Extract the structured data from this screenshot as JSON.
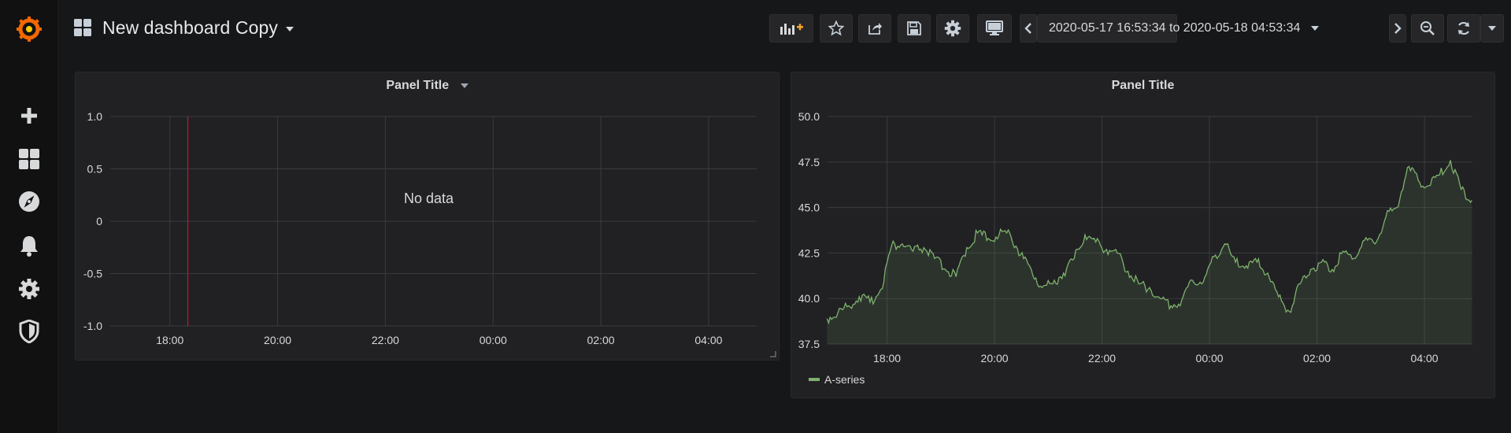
{
  "dashboard": {
    "title": "New dashboard Copy"
  },
  "toolbar": {
    "buttons": [
      "add-panel-icon",
      "star-icon",
      "share-icon",
      "save-icon",
      "gear-icon",
      "tv-mode-icon"
    ],
    "time_range": "2020-05-17 16:53:34 to 2020-05-18 04:53:34"
  },
  "sidebar": {
    "icons": [
      "grafana-logo-icon",
      "plus-icon",
      "dashboards-icon",
      "explore-compass-icon",
      "bell-icon",
      "gear-icon",
      "shield-icon"
    ]
  },
  "colors": {
    "series": "#7eb26d",
    "threshold_line": "#c4162a",
    "logo": "#f46800"
  },
  "panels": [
    {
      "title": "Panel Title",
      "message": "No data"
    },
    {
      "title": "Panel Title",
      "legend": "A-series"
    }
  ],
  "chart_data": [
    {
      "type": "line",
      "title": "Panel Title",
      "x_ticks": [
        "18:00",
        "20:00",
        "22:00",
        "00:00",
        "02:00",
        "04:00"
      ],
      "y_ticks": [
        "1.0",
        "0.5",
        "0",
        "-0.5",
        "-1.0"
      ],
      "ylim": [
        -1.0,
        1.0
      ],
      "xlim": [
        "2020-05-17 16:53:34",
        "2020-05-18 04:53:34"
      ],
      "series": [],
      "annotation_time": "2020-05-17 18:20",
      "grid": true
    },
    {
      "type": "area",
      "title": "Panel Title",
      "x_ticks": [
        "18:00",
        "20:00",
        "22:00",
        "00:00",
        "02:00",
        "04:00"
      ],
      "y_ticks": [
        "50.0",
        "47.5",
        "45.0",
        "42.5",
        "40.0",
        "37.5"
      ],
      "ylim": [
        37.5,
        50.0
      ],
      "xlim": [
        "2020-05-17 16:53:34",
        "2020-05-18 04:53:34"
      ],
      "grid": true,
      "legend": "bottom-left",
      "series": [
        {
          "name": "A-series",
          "points": [
            [
              "2020-05-17 16:53",
              38.9
            ],
            [
              "2020-05-17 17:05",
              39.2
            ],
            [
              "2020-05-17 17:17",
              39.6
            ],
            [
              "2020-05-17 17:29",
              40.1
            ],
            [
              "2020-05-17 17:41",
              39.8
            ],
            [
              "2020-05-17 17:53",
              40.5
            ],
            [
              "2020-05-17 18:05",
              42.9
            ],
            [
              "2020-05-17 18:17",
              43.0
            ],
            [
              "2020-05-17 18:29",
              42.6
            ],
            [
              "2020-05-17 18:41",
              42.8
            ],
            [
              "2020-05-17 18:53",
              42.2
            ],
            [
              "2020-05-17 19:05",
              41.6
            ],
            [
              "2020-05-17 19:17",
              41.2
            ],
            [
              "2020-05-17 19:29",
              42.8
            ],
            [
              "2020-05-17 19:41",
              43.6
            ],
            [
              "2020-05-17 19:53",
              43.3
            ],
            [
              "2020-05-17 20:05",
              43.5
            ],
            [
              "2020-05-17 20:17",
              43.6
            ],
            [
              "2020-05-17 20:29",
              42.4
            ],
            [
              "2020-05-17 20:41",
              41.6
            ],
            [
              "2020-05-17 20:53",
              40.6
            ],
            [
              "2020-05-17 21:05",
              40.8
            ],
            [
              "2020-05-17 21:17",
              41.4
            ],
            [
              "2020-05-17 21:29",
              42.2
            ],
            [
              "2020-05-17 21:41",
              43.5
            ],
            [
              "2020-05-17 21:53",
              43.1
            ],
            [
              "2020-05-17 22:05",
              42.7
            ],
            [
              "2020-05-17 22:17",
              42.5
            ],
            [
              "2020-05-17 22:29",
              41.5
            ],
            [
              "2020-05-17 22:41",
              40.8
            ],
            [
              "2020-05-17 22:53",
              40.6
            ],
            [
              "2020-05-17 23:05",
              40.0
            ],
            [
              "2020-05-17 23:17",
              39.6
            ],
            [
              "2020-05-17 23:29",
              39.9
            ],
            [
              "2020-05-17 23:41",
              41.0
            ],
            [
              "2020-05-17 23:53",
              40.9
            ],
            [
              "2020-05-18 00:05",
              42.3
            ],
            [
              "2020-05-18 00:17",
              43.0
            ],
            [
              "2020-05-18 00:29",
              42.0
            ],
            [
              "2020-05-18 00:41",
              41.8
            ],
            [
              "2020-05-18 00:53",
              42.0
            ],
            [
              "2020-05-18 01:05",
              41.4
            ],
            [
              "2020-05-18 01:17",
              40.1
            ],
            [
              "2020-05-18 01:29",
              39.3
            ],
            [
              "2020-05-18 01:41",
              40.8
            ],
            [
              "2020-05-18 01:53",
              41.6
            ],
            [
              "2020-05-18 02:05",
              42.0
            ],
            [
              "2020-05-18 02:17",
              41.6
            ],
            [
              "2020-05-18 02:29",
              42.6
            ],
            [
              "2020-05-18 02:41",
              42.2
            ],
            [
              "2020-05-18 02:53",
              43.2
            ],
            [
              "2020-05-18 03:05",
              43.0
            ],
            [
              "2020-05-18 03:17",
              44.5
            ],
            [
              "2020-05-18 03:29",
              45.0
            ],
            [
              "2020-05-18 03:41",
              47.2
            ],
            [
              "2020-05-18 03:53",
              46.5
            ],
            [
              "2020-05-18 04:05",
              46.2
            ],
            [
              "2020-05-18 04:17",
              46.8
            ],
            [
              "2020-05-18 04:29",
              47.6
            ],
            [
              "2020-05-18 04:41",
              46.0
            ],
            [
              "2020-05-18 04:53",
              45.4
            ]
          ]
        }
      ]
    }
  ]
}
